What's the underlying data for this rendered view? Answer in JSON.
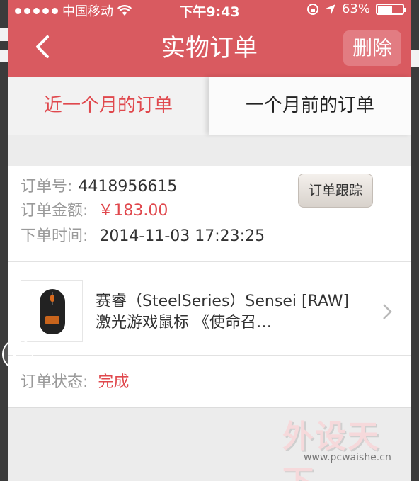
{
  "status_bar": {
    "carrier": "中国移动",
    "time": "下午9:43",
    "battery_text": "63%",
    "battery_level": 0.63
  },
  "nav": {
    "title": "实物订单",
    "delete_label": "删除"
  },
  "tabs": [
    {
      "label": "近一个月的订单",
      "active": true
    },
    {
      "label": "一个月前的订单",
      "active": false
    }
  ],
  "order": {
    "number_label": "订单号:",
    "number": "4418956615",
    "amount_label": "订单金额:",
    "amount": "￥183.00",
    "time_label": "下单时间:",
    "time": "2014-11-03 17:23:25",
    "track_label": "订单跟踪",
    "product_name": "赛睿（SteelSeries）Sensei [RAW] 激光游戏鼠标 《使命召…",
    "status_label": "订单状态:",
    "status": "完成"
  },
  "watermark": {
    "title": "外设天下",
    "url": "www.pcwaishe.cn"
  },
  "colors": {
    "brand": "#d95a60",
    "accent_red": "#e0484d"
  }
}
